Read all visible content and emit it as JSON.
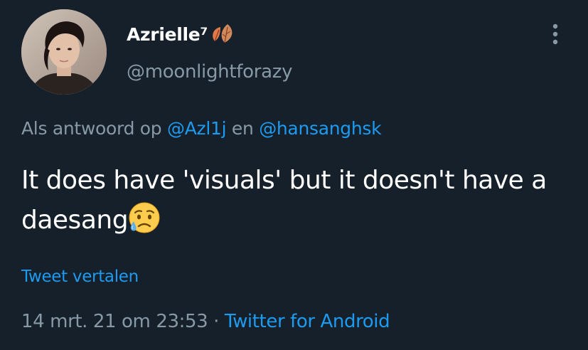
{
  "author": {
    "display_name": "Azrielle⁷",
    "name_emoji_icon": "fallen-leaf-icon",
    "handle": "@moonlightforazy",
    "avatar_icon": "profile-photo"
  },
  "menu": {
    "icon": "more-vertical-icon"
  },
  "reply": {
    "prefix": "Als antwoord op",
    "mention1": "@Azl1j",
    "conjunction": "en",
    "mention2": "@hansanghsk"
  },
  "tweet": {
    "text": "It does have 'visuals' but it doesn't have a daesang",
    "emoji_icon": "sad-but-relieved-face-icon",
    "translate_label": "Tweet vertalen"
  },
  "meta": {
    "date": "14 mrt. 21 om 23:53",
    "separator": "·",
    "client": "Twitter for Android"
  },
  "colors": {
    "background": "#15202b",
    "text_primary": "#ffffff",
    "text_secondary": "#8899a6",
    "accent": "#1d9bf0"
  }
}
